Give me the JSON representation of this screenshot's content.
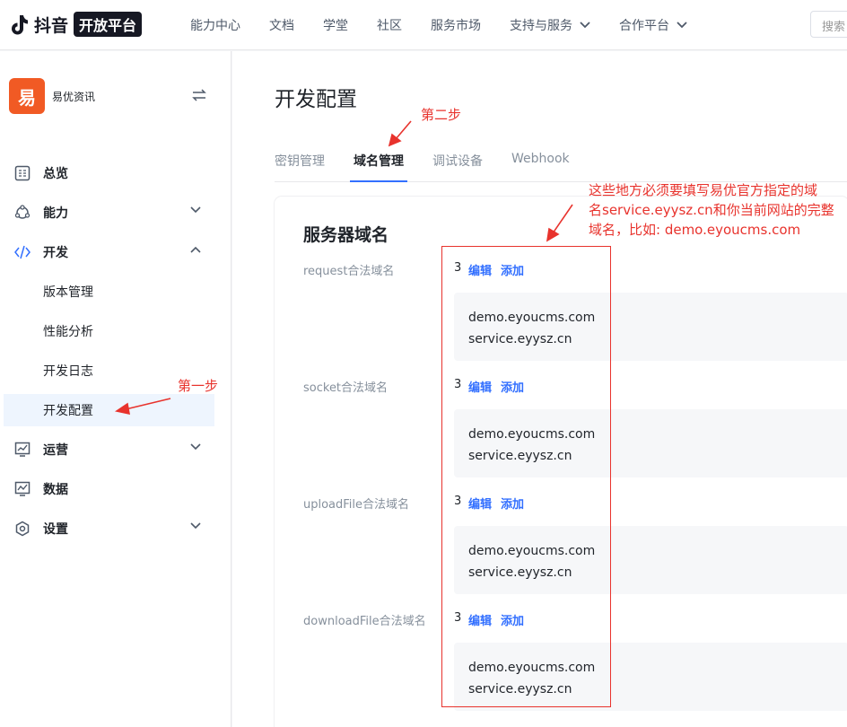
{
  "topbar": {
    "brand": "抖音",
    "badge": "开放平台",
    "nav": [
      {
        "label": "能力中心",
        "has_chevron": false
      },
      {
        "label": "文档",
        "has_chevron": false
      },
      {
        "label": "学堂",
        "has_chevron": false
      },
      {
        "label": "社区",
        "has_chevron": false
      },
      {
        "label": "服务市场",
        "has_chevron": false
      },
      {
        "label": "支持与服务",
        "has_chevron": true
      },
      {
        "label": "合作平台",
        "has_chevron": true
      }
    ],
    "search_placeholder": "搜索"
  },
  "sidebar": {
    "app_icon_text": "易",
    "app_name": "易优资讯",
    "items": [
      {
        "label": "总览",
        "icon": "overview-icon"
      },
      {
        "label": "能力",
        "icon": "capability-icon",
        "chevron": "down"
      },
      {
        "label": "开发",
        "icon": "code-icon",
        "chevron": "up"
      },
      {
        "label": "运营",
        "icon": "operation-icon",
        "chevron": "down"
      },
      {
        "label": "数据",
        "icon": "data-icon"
      },
      {
        "label": "设置",
        "icon": "settings-icon",
        "chevron": "down"
      }
    ],
    "sub_items": [
      {
        "label": "版本管理"
      },
      {
        "label": "性能分析"
      },
      {
        "label": "开发日志"
      },
      {
        "label": "开发配置",
        "active": true
      }
    ]
  },
  "main": {
    "title": "开发配置",
    "tabs": [
      {
        "label": "密钥管理"
      },
      {
        "label": "域名管理",
        "active": true
      },
      {
        "label": "调试设备"
      },
      {
        "label": "Webhook"
      }
    ],
    "section_title": "服务器域名",
    "edit_label": "编辑",
    "add_label": "添加",
    "domains": [
      {
        "label": "request合法域名",
        "count": "3",
        "values": [
          "demo.eyoucms.com",
          "service.eyysz.cn"
        ]
      },
      {
        "label": "socket合法域名",
        "count": "3",
        "values": [
          "demo.eyoucms.com",
          "service.eyysz.cn"
        ]
      },
      {
        "label": "uploadFile合法域名",
        "count": "3",
        "values": [
          "demo.eyoucms.com",
          "service.eyysz.cn"
        ]
      },
      {
        "label": "downloadFile合法域名",
        "count": "3",
        "values": [
          "demo.eyoucms.com",
          "service.eyysz.cn"
        ]
      }
    ]
  },
  "annotations": {
    "step1": "第一步",
    "step2": "第二步",
    "note_lines": [
      "这些地方必须要填写易优官方指定的域",
      "名service.eyysz.cn和你当前网站的完整",
      "域名，比如: demo.eyoucms.com"
    ],
    "color": "#e8332d"
  },
  "colors": {
    "accent": "#3370ff",
    "app_icon": "#f15a24",
    "active_bg": "#eef5fe"
  }
}
